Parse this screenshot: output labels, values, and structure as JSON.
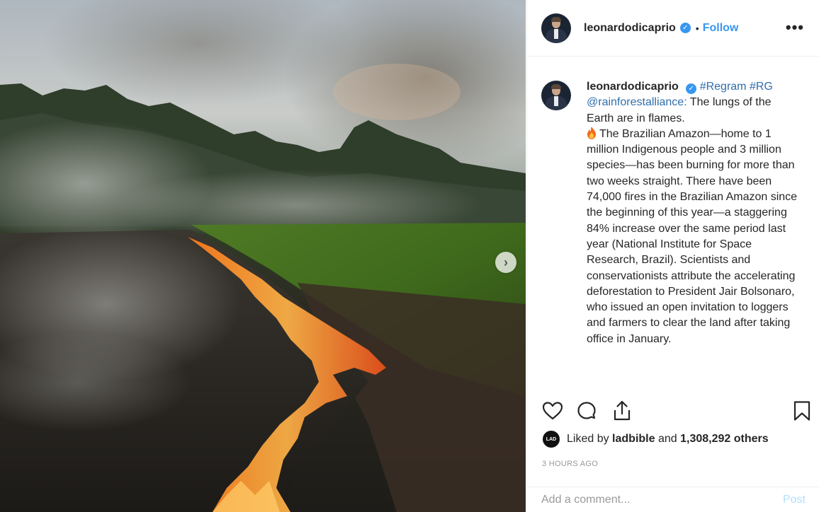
{
  "post": {
    "username": "leonardodicaprio",
    "verified_symbol": "✓",
    "separator": "•",
    "follow_label": "Follow",
    "more_label": "•••",
    "next_arrow": "›"
  },
  "caption": {
    "username": "leonardodicaprio",
    "tags": "#Regram #RG",
    "mention": "@rainforestalliance:",
    "line1": "The lungs of the Earth are in flames.",
    "body": "The Brazilian Amazon—home to 1 million Indigenous people and 3 million species—has been burning for more than two weeks straight. There have been 74,000 fires in the Brazilian Amazon since the beginning of this year—a staggering 84% increase over the same period last year (National Institute for Space Research, Brazil). Scientists and conservationists attribute the accelerating deforestation to President Jair Bolsonaro, who issued an open invitation to loggers and farmers to clear the land after taking office in January."
  },
  "likes": {
    "avatar_text": "LAD",
    "prefix": "Liked by",
    "user": "ladbible",
    "and": "and",
    "count": "1,308,292 others"
  },
  "timestamp": "3 HOURS AGO",
  "comment": {
    "placeholder": "Add a comment...",
    "post_label": "Post"
  },
  "icons": {
    "like": "heart-icon",
    "comment": "comment-bubble-icon",
    "share": "share-icon",
    "save": "bookmark-icon",
    "fire": "fire-emoji-icon"
  },
  "colors": {
    "accent": "#3897f0",
    "text": "#262626",
    "muted": "#999999",
    "post_disabled": "#b2dffc"
  }
}
